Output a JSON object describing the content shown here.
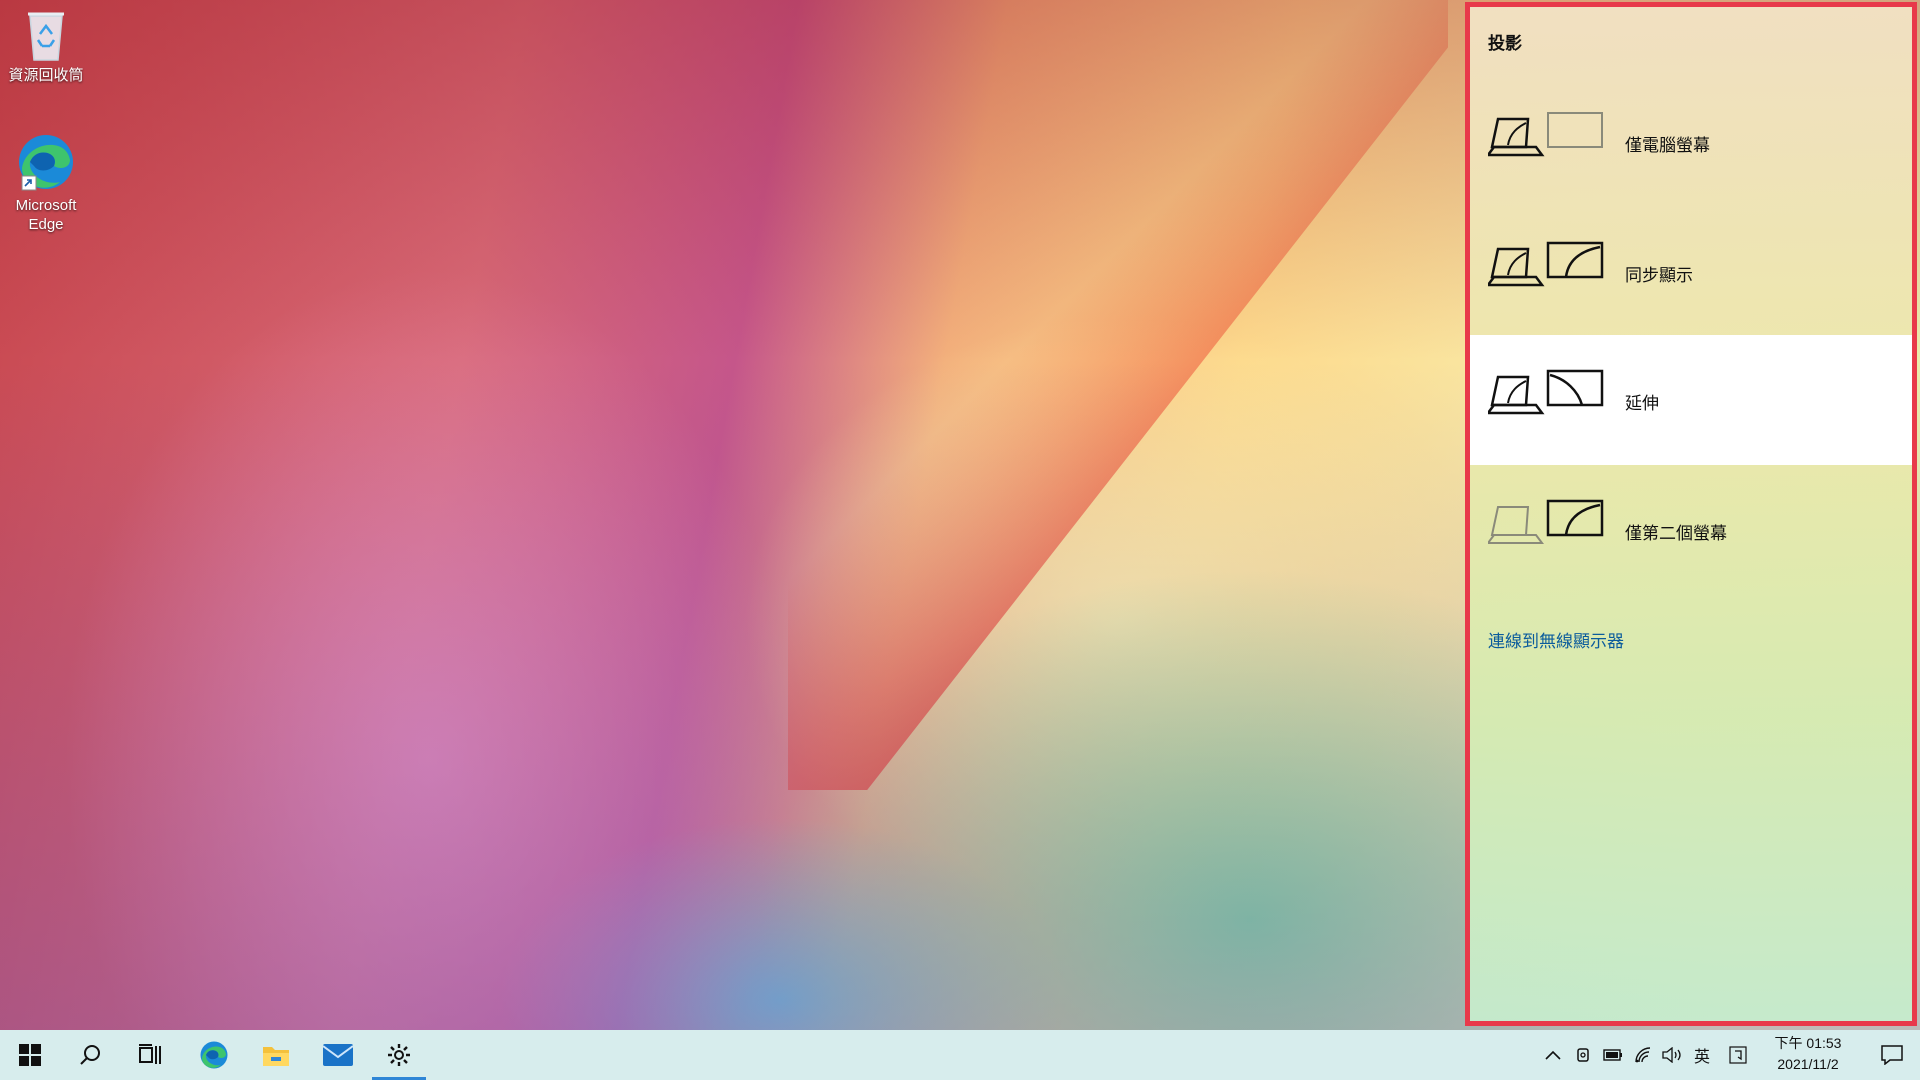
{
  "desktop": {
    "icons": [
      {
        "label": "資源回收筒",
        "icon": "recycle-bin-icon"
      },
      {
        "label": "Microsoft Edge",
        "icon": "edge-icon"
      }
    ]
  },
  "project_panel": {
    "title": "投影",
    "options": [
      {
        "label": "僅電腦螢幕",
        "icon": "pc-screen-only-icon",
        "selected": false
      },
      {
        "label": "同步顯示",
        "icon": "duplicate-icon",
        "selected": false
      },
      {
        "label": "延伸",
        "icon": "extend-icon",
        "selected": true
      },
      {
        "label": "僅第二個螢幕",
        "icon": "second-screen-only-icon",
        "selected": false
      }
    ],
    "wireless_link": "連線到無線顯示器",
    "border_color": "#e8394a"
  },
  "taskbar": {
    "apps": [
      {
        "name": "start",
        "icon": "windows-logo-icon"
      },
      {
        "name": "search",
        "icon": "search-icon"
      },
      {
        "name": "task-view",
        "icon": "task-view-icon"
      },
      {
        "name": "edge",
        "icon": "edge-icon"
      },
      {
        "name": "file-explorer",
        "icon": "folder-icon"
      },
      {
        "name": "mail",
        "icon": "mail-icon"
      },
      {
        "name": "settings",
        "icon": "gear-icon",
        "active": true
      }
    ],
    "tray": {
      "chevron": "chevron-up-icon",
      "language": "英",
      "time": "下午 01:53",
      "date": "2021/11/2"
    }
  }
}
